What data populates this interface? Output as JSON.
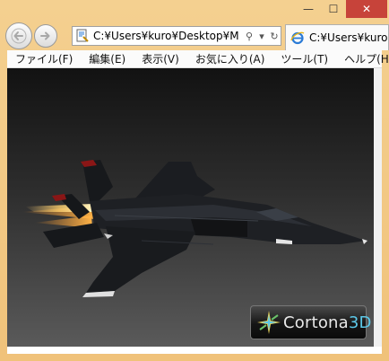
{
  "window": {
    "minimize_glyph": "—",
    "maximize_glyph": "☐",
    "close_glyph": "✕"
  },
  "nav": {
    "back_icon": "arrow-left-icon",
    "forward_icon": "arrow-right-icon",
    "address_value": "C:¥Users¥kuro¥Desktop¥M",
    "search_glyph": "⚲",
    "dropdown_glyph": "▾",
    "refresh_glyph": "↻"
  },
  "tab": {
    "title": "C:¥Users¥kuro¥"
  },
  "menu": {
    "items": [
      "ファイル(F)",
      "編集(E)",
      "表示(V)",
      "お気に入り(A)",
      "ツール(T)",
      "ヘルプ(H)"
    ]
  },
  "viewer": {
    "logo_text_main": "Cortona",
    "logo_text_accent": "3D"
  },
  "colors": {
    "frame": "#f2c77b",
    "close_button": "#c7433a",
    "ie_accent": "#2b7bd6",
    "cortona_accent": "#5cc8e8"
  }
}
